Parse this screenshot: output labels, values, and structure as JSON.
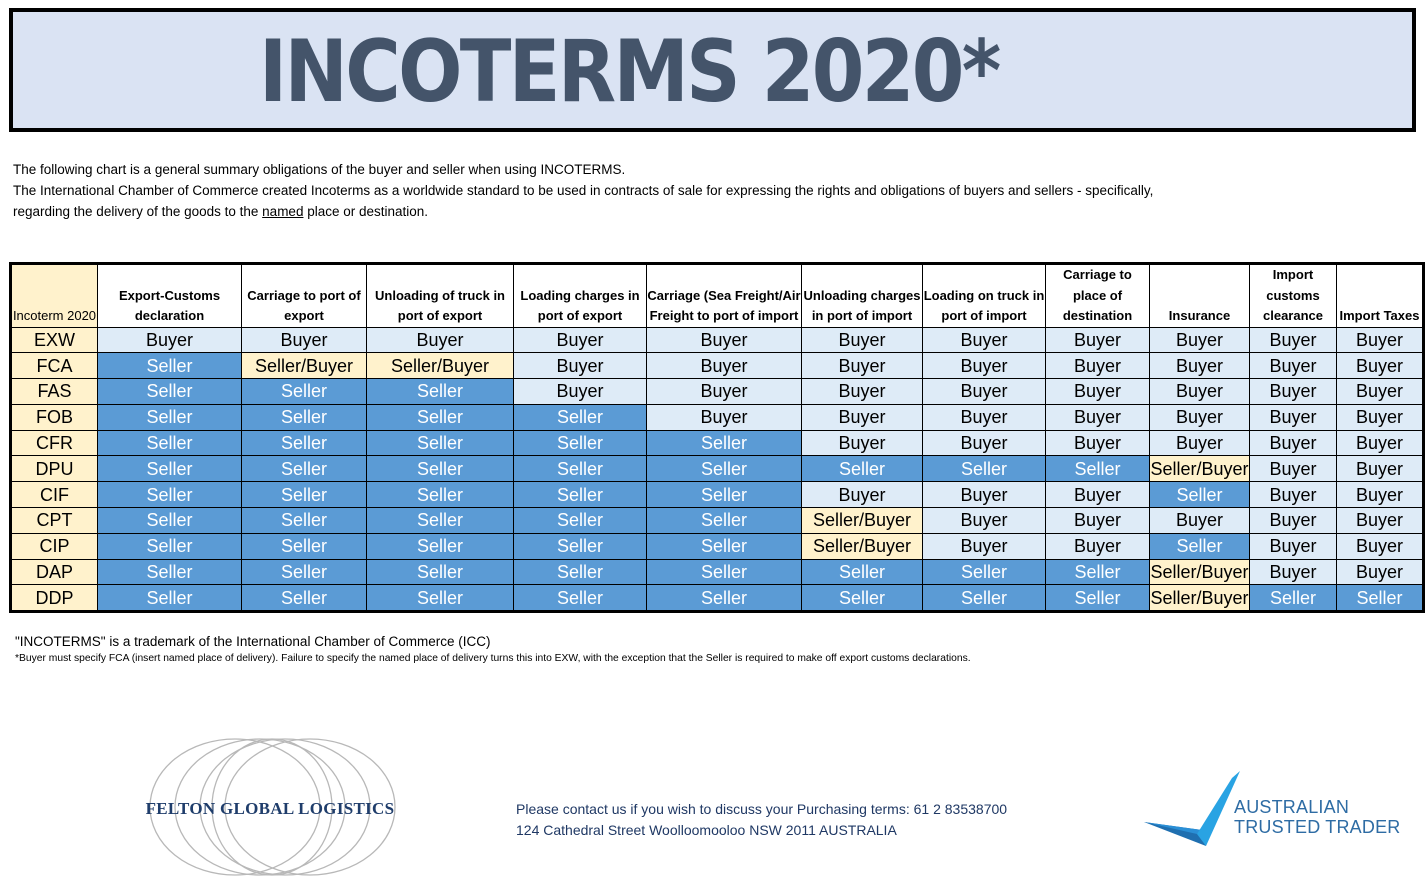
{
  "title": "INCOTERMS 2020*",
  "intro": {
    "line1": "The following chart is a general summary obligations of the buyer and seller when using INCOTERMS.",
    "line2": "The International Chamber of Commerce created Incoterms as a worldwide standard to be used in contracts of sale for expressing the rights and obligations of buyers and sellers - specifically,",
    "line3_before": "regarding the delivery of the goods to the ",
    "line3_underlined": "named",
    "line3_after": " place or destination."
  },
  "colors": {
    "seller": "#5b9bd5",
    "buyer": "#deebf7",
    "shared": "#fff2cc",
    "title_bg": "#dae3f3",
    "title_text": "#44546a"
  },
  "table": {
    "headers": [
      "Incoterm 2020",
      "Export-Customs declaration",
      "Carriage to port of export",
      "Unloading of truck in port of export",
      "Loading charges in port of export",
      "Carriage (Sea Freight/Air Freight to port of import",
      "Unloading charges in port of import",
      "Loading on truck in port of import",
      "Carriage to place of destination",
      "Insurance",
      "Import customs clearance",
      "Import Taxes"
    ],
    "rows": [
      {
        "term": "EXW",
        "cells": [
          "Buyer",
          "Buyer",
          "Buyer",
          "Buyer",
          "Buyer",
          "Buyer",
          "Buyer",
          "Buyer",
          "Buyer",
          "Buyer",
          "Buyer"
        ]
      },
      {
        "term": "FCA",
        "cells": [
          "Seller",
          "Seller/Buyer",
          "Seller/Buyer",
          "Buyer",
          "Buyer",
          "Buyer",
          "Buyer",
          "Buyer",
          "Buyer",
          "Buyer",
          "Buyer"
        ]
      },
      {
        "term": "FAS",
        "cells": [
          "Seller",
          "Seller",
          "Seller",
          "Buyer",
          "Buyer",
          "Buyer",
          "Buyer",
          "Buyer",
          "Buyer",
          "Buyer",
          "Buyer"
        ]
      },
      {
        "term": "FOB",
        "cells": [
          "Seller",
          "Seller",
          "Seller",
          "Seller",
          "Buyer",
          "Buyer",
          "Buyer",
          "Buyer",
          "Buyer",
          "Buyer",
          "Buyer"
        ]
      },
      {
        "term": "CFR",
        "cells": [
          "Seller",
          "Seller",
          "Seller",
          "Seller",
          "Seller",
          "Buyer",
          "Buyer",
          "Buyer",
          "Buyer",
          "Buyer",
          "Buyer"
        ]
      },
      {
        "term": "DPU",
        "cells": [
          "Seller",
          "Seller",
          "Seller",
          "Seller",
          "Seller",
          "Seller",
          "Seller",
          "Seller",
          "Seller/Buyer",
          "Buyer",
          "Buyer"
        ]
      },
      {
        "term": "CIF",
        "cells": [
          "Seller",
          "Seller",
          "Seller",
          "Seller",
          "Seller",
          "Buyer",
          "Buyer",
          "Buyer",
          "Seller",
          "Buyer",
          "Buyer"
        ]
      },
      {
        "term": "CPT",
        "cells": [
          "Seller",
          "Seller",
          "Seller",
          "Seller",
          "Seller",
          "Seller/Buyer",
          "Buyer",
          "Buyer",
          "Buyer",
          "Buyer",
          "Buyer"
        ]
      },
      {
        "term": "CIP",
        "cells": [
          "Seller",
          "Seller",
          "Seller",
          "Seller",
          "Seller",
          "Seller/Buyer",
          "Buyer",
          "Buyer",
          "Seller",
          "Buyer",
          "Buyer"
        ]
      },
      {
        "term": "DAP",
        "cells": [
          "Seller",
          "Seller",
          "Seller",
          "Seller",
          "Seller",
          "Seller",
          "Seller",
          "Seller",
          "Seller/Buyer",
          "Buyer",
          "Buyer"
        ]
      },
      {
        "term": "DDP",
        "cells": [
          "Seller",
          "Seller",
          "Seller",
          "Seller",
          "Seller",
          "Seller",
          "Seller",
          "Seller",
          "Seller/Buyer",
          "Seller",
          "Seller"
        ]
      }
    ]
  },
  "notes": {
    "trademark": "\"INCOTERMS\" is a trademark of the International Chamber of Commerce (ICC)",
    "footnote": "*Buyer must specify FCA (insert named place of delivery).  Failure to specify the named place of delivery turns this into EXW, with the exception that the Seller is required to make off export customs declarations."
  },
  "footer": {
    "company_logo_text": "FELTON GLOBAL LOGISTICS",
    "contact_line1": "Please contact us if you wish to discuss your Purchasing terms:  61 2 83538700",
    "contact_line2": "124 Cathedral Street Woolloomooloo NSW 2011  AUSTRALIA",
    "att_logo_line1": "AUSTRALIAN",
    "att_logo_line2": "TRUSTED TRADER"
  }
}
